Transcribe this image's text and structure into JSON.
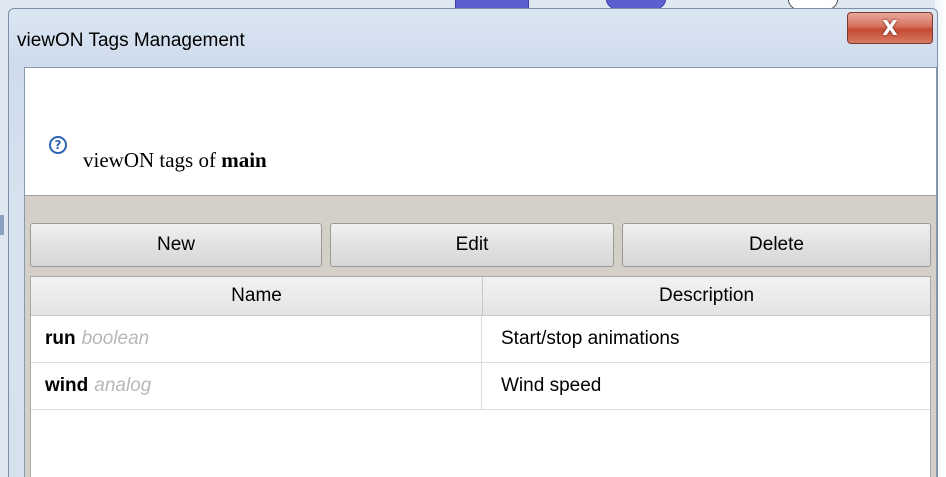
{
  "window": {
    "title": "viewON Tags Management",
    "close_symbol": "X"
  },
  "header": {
    "icon": "help-icon",
    "prefix": "viewON tags of ",
    "object_name": "main"
  },
  "toolbar": {
    "new_label": "New",
    "edit_label": "Edit",
    "delete_label": "Delete"
  },
  "table": {
    "columns": [
      "Name",
      "Description"
    ],
    "rows": [
      {
        "name": "run",
        "type": "boolean",
        "description": "Start/stop animations"
      },
      {
        "name": "wind",
        "type": "analog",
        "description": "Wind speed"
      }
    ]
  },
  "colors": {
    "close_button": "#c44a33",
    "help_icon": "#2d64b6",
    "type_hint": "#b8b8b8"
  }
}
